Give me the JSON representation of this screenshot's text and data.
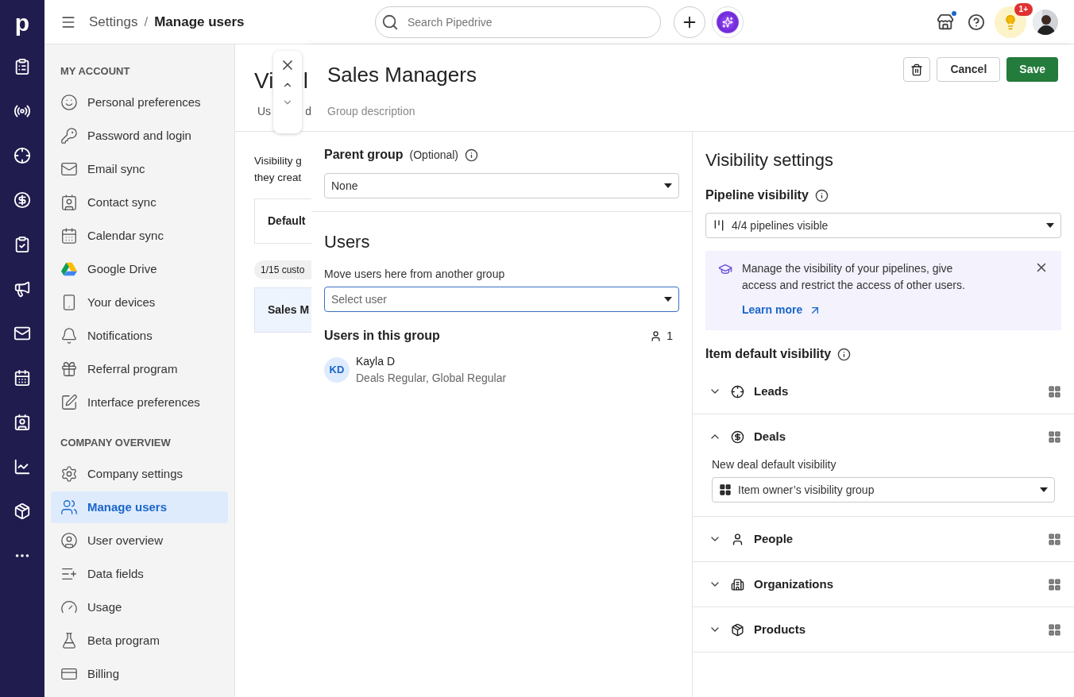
{
  "logo": "p",
  "header": {
    "breadcrumb": [
      {
        "label": "Settings",
        "current": false
      },
      {
        "label": "Manage users",
        "current": true
      }
    ],
    "separator": "/",
    "search": {
      "placeholder": "Search Pipedrive"
    },
    "notification_badge": "1+"
  },
  "settings_nav": [
    {
      "heading": "MY ACCOUNT",
      "items": [
        {
          "label": "Personal preferences",
          "selected": false
        },
        {
          "label": "Password and login",
          "selected": false
        },
        {
          "label": "Email sync",
          "selected": false
        },
        {
          "label": "Contact sync",
          "selected": false
        },
        {
          "label": "Calendar sync",
          "selected": false
        },
        {
          "label": "Google Drive",
          "selected": false
        },
        {
          "label": "Your devices",
          "selected": false
        },
        {
          "label": "Notifications",
          "selected": false
        },
        {
          "label": "Referral program",
          "selected": false
        },
        {
          "label": "Interface preferences",
          "selected": false
        }
      ]
    },
    {
      "heading": "COMPANY OVERVIEW",
      "items": [
        {
          "label": "Company settings",
          "selected": false
        },
        {
          "label": "Manage users",
          "selected": true
        },
        {
          "label": "User overview",
          "selected": false
        },
        {
          "label": "Data fields",
          "selected": false
        },
        {
          "label": "Usage",
          "selected": false
        },
        {
          "label": "Beta program",
          "selected": false
        },
        {
          "label": "Billing",
          "selected": false
        }
      ]
    }
  ],
  "background_page": {
    "heading_parts": [
      "Vi",
      "l"
    ],
    "tab_parts": [
      "Us",
      "d"
    ],
    "intro_lines": [
      "Visibility g",
      "they creat"
    ],
    "default_card": "Default",
    "count_pill": "1/15 custo",
    "group_card": "Sales M"
  },
  "drawer": {
    "title": "Sales Managers",
    "description": {
      "placeholder": "Group description"
    },
    "buttons": [
      {
        "kind": "delete"
      },
      {
        "kind": "secondary",
        "label": "Cancel"
      },
      {
        "kind": "primary",
        "label": "Save"
      }
    ],
    "parent_group": {
      "label": "Parent group",
      "hint": "(Optional)",
      "value": "None"
    },
    "users": {
      "heading": "Users",
      "move_label": "Move users here from another group",
      "select": {
        "placeholder": "Select user"
      },
      "list_heading": "Users in this group",
      "count": "1",
      "members": [
        {
          "initials": "KD",
          "name": "Kayla D",
          "roles": "Deals Regular, Global Regular"
        }
      ]
    },
    "visibility": {
      "heading": "Visibility settings",
      "pipeline_label": "Pipeline visibility",
      "pipeline_value": "4/4 pipelines visible",
      "info": {
        "text": "Manage the visibility of your pipelines, give access and restrict the access of other users.",
        "link": "Learn more"
      },
      "item_label": "Item default visibility",
      "items": [
        {
          "kind": "leads",
          "label": "Leads",
          "expanded": false
        },
        {
          "kind": "deals",
          "label": "Deals",
          "expanded": true,
          "field_label": "New deal default visibility",
          "field_value": "Item owner’s visibility group"
        },
        {
          "kind": "people",
          "label": "People",
          "expanded": false
        },
        {
          "kind": "organizations",
          "label": "Organizations",
          "expanded": false
        },
        {
          "kind": "products",
          "label": "Products",
          "expanded": false
        }
      ]
    }
  }
}
